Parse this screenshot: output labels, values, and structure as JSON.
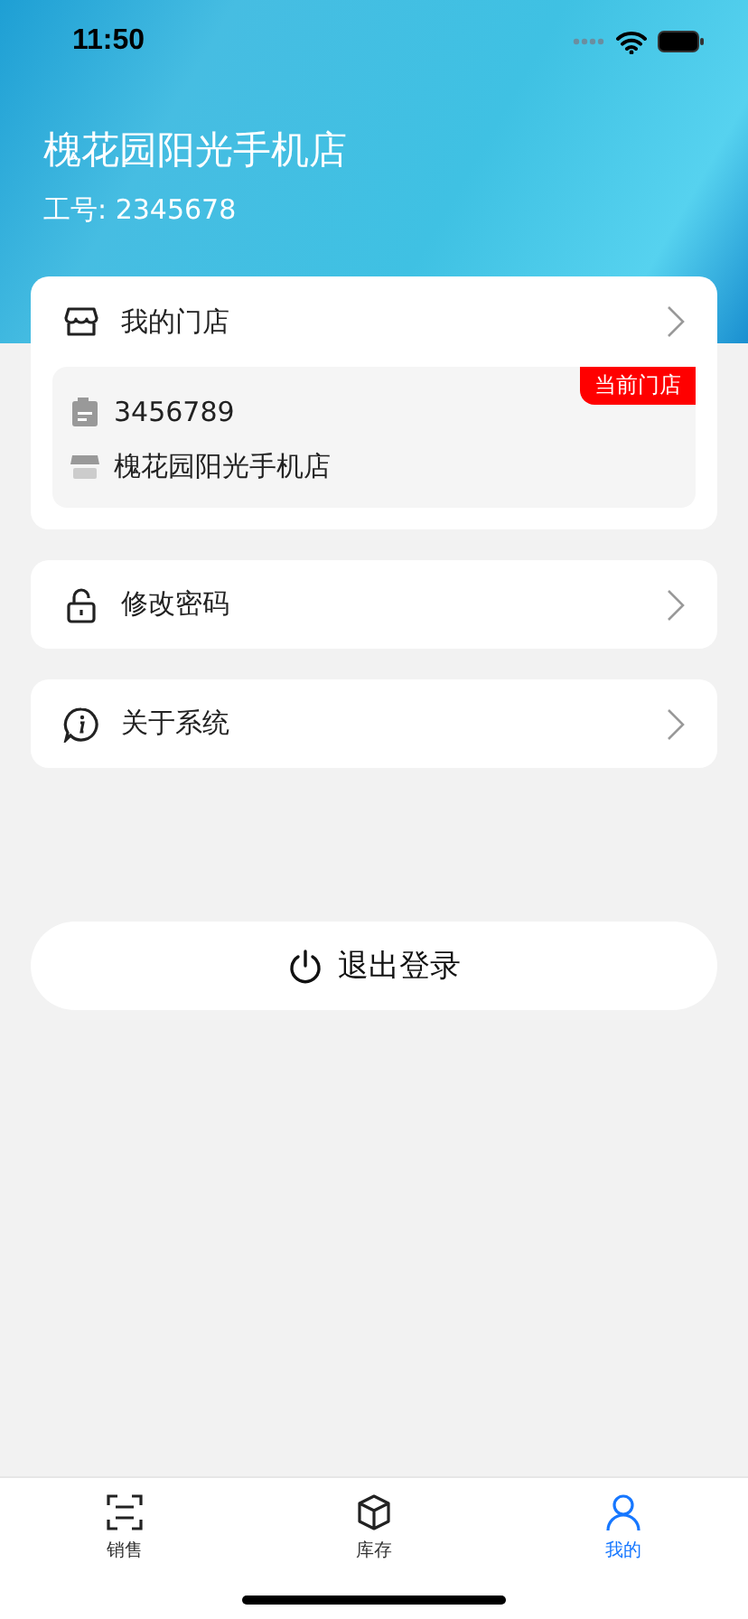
{
  "status_bar": {
    "time": "11:50"
  },
  "header": {
    "store_name": "槐花园阳光手机店",
    "employee_id": "工号: 2345678"
  },
  "my_store": {
    "title": "我的门店",
    "store": {
      "code": "3456789",
      "name": "槐花园阳光手机店",
      "badge": "当前门店"
    }
  },
  "menu": [
    {
      "kind": "password",
      "label": "修改密码"
    },
    {
      "kind": "about",
      "label": "关于系统"
    }
  ],
  "logout": {
    "label": "退出登录"
  },
  "tabs": [
    {
      "kind": "sales",
      "label": "销售",
      "selected": false
    },
    {
      "kind": "stock",
      "label": "库存",
      "selected": false
    },
    {
      "kind": "mine",
      "label": "我的",
      "selected": true
    }
  ]
}
